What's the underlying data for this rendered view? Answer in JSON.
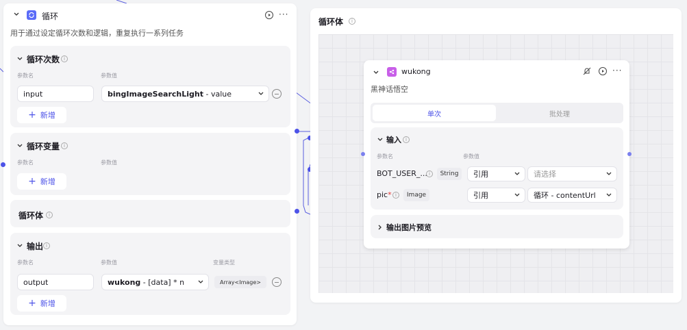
{
  "loop_node": {
    "title": "循环",
    "desc": "用于通过设定循环次数和逻辑，重复执行一系列任务",
    "count_section": {
      "title": "循环次数",
      "col_name": "参数名",
      "col_value": "参数值",
      "param_name": "input",
      "param_value_bold": "bingImageSearchLight",
      "param_value_rest": " - value",
      "add_label": "新增"
    },
    "vars_section": {
      "title": "循环变量",
      "col_name": "参数名",
      "col_value": "参数值",
      "add_label": "新增"
    },
    "body_section": {
      "title": "循环体"
    },
    "output_section": {
      "title": "输出",
      "col_name": "参数名",
      "col_value": "参数值",
      "col_type": "变量类型",
      "param_name": "output",
      "param_value_bold": "wukong",
      "param_value_rest": " - [data] * n",
      "type_tag": "Array<Image>",
      "add_label": "新增"
    }
  },
  "loop_body": {
    "title": "循环体"
  },
  "wukong_node": {
    "title": "wukong",
    "desc": "黑神话悟空",
    "tabs": [
      "单次",
      "批处理"
    ],
    "input_section": {
      "title": "输入",
      "col_name": "参数名",
      "col_value": "参数值",
      "rows": [
        {
          "name": "BOT_USER_...",
          "type": "String",
          "ref": "引用",
          "value": "请选择"
        },
        {
          "name": "pic",
          "required": "*",
          "type": "Image",
          "ref": "引用",
          "value": "循环 - contentUrl"
        }
      ]
    },
    "preview_section": {
      "title": "输出图片预览"
    }
  },
  "colors": {
    "accent": "#4d53e8",
    "loop_icon": "#5b6cf8",
    "plugin_icon": "#c85fe8"
  }
}
